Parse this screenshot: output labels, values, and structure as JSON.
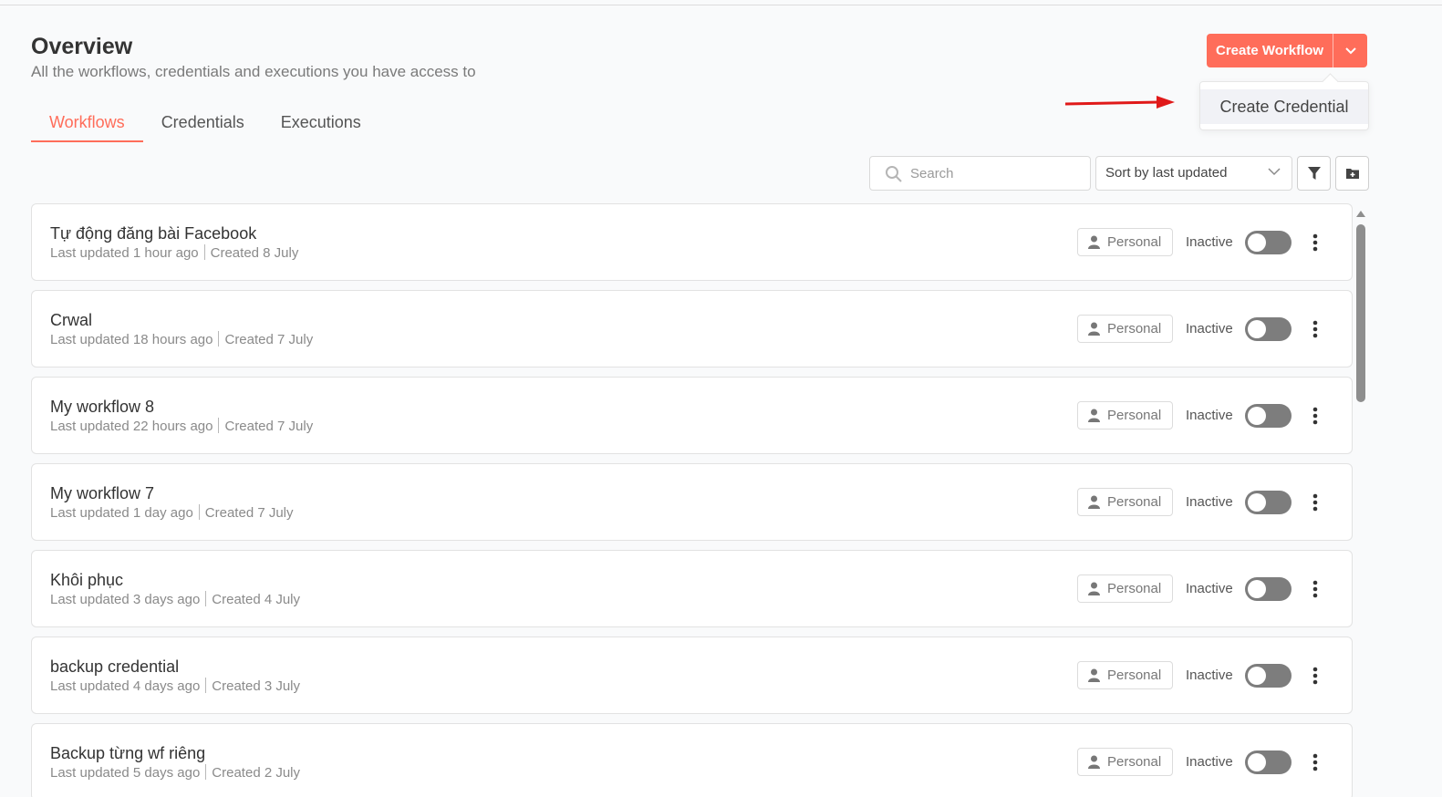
{
  "header": {
    "title": "Overview",
    "subtitle": "All the workflows, credentials and executions you have access to"
  },
  "tabs": [
    {
      "label": "Workflows",
      "active": true
    },
    {
      "label": "Credentials",
      "active": false
    },
    {
      "label": "Executions",
      "active": false
    }
  ],
  "actions": {
    "create_label": "Create Workflow",
    "dropdown_item": "Create Credential",
    "accent_color": "#ff6d5a",
    "annotation_arrow_color": "#e01919"
  },
  "toolbar": {
    "search_placeholder": "Search",
    "sort_label": "Sort by last updated",
    "filter_icon": "filter-icon",
    "folder_icon": "folder-plus-icon"
  },
  "workflows": [
    {
      "name": "Tự động đăng bài Facebook",
      "updated": "Last updated 1 hour ago",
      "created": "Created 8 July",
      "owner": "Personal",
      "status": "Inactive"
    },
    {
      "name": "Crwal",
      "updated": "Last updated 18 hours ago",
      "created": "Created 7 July",
      "owner": "Personal",
      "status": "Inactive"
    },
    {
      "name": "My workflow 8",
      "updated": "Last updated 22 hours ago",
      "created": "Created 7 July",
      "owner": "Personal",
      "status": "Inactive"
    },
    {
      "name": "My workflow 7",
      "updated": "Last updated 1 day ago",
      "created": "Created 7 July",
      "owner": "Personal",
      "status": "Inactive"
    },
    {
      "name": "Khôi phục",
      "updated": "Last updated 3 days ago",
      "created": "Created 4 July",
      "owner": "Personal",
      "status": "Inactive"
    },
    {
      "name": "backup credential",
      "updated": "Last updated 4 days ago",
      "created": "Created 3 July",
      "owner": "Personal",
      "status": "Inactive"
    },
    {
      "name": "Backup từng wf riêng",
      "updated": "Last updated 5 days ago",
      "created": "Created 2 July",
      "owner": "Personal",
      "status": "Inactive"
    }
  ]
}
